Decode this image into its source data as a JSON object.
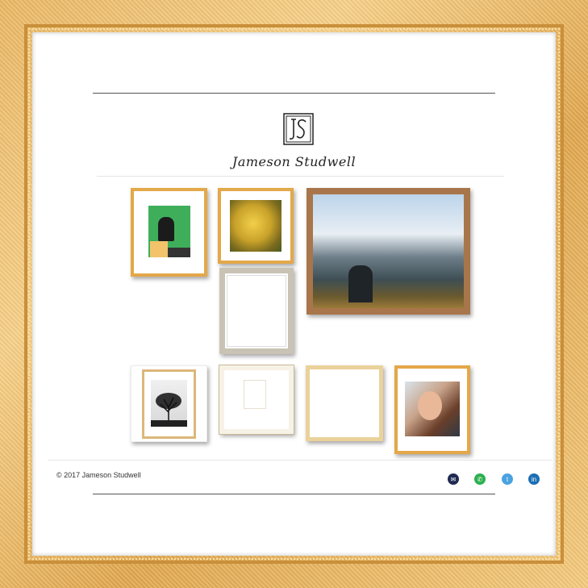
{
  "brand": {
    "name": "Jameson Studwell",
    "logo_letters": "JS"
  },
  "footer": {
    "copyright": "© 2017 Jameson Studwell"
  },
  "social": [
    {
      "icon": "email-icon",
      "color": "#1f2a52"
    },
    {
      "icon": "phone-icon",
      "color": "#2bb04f"
    },
    {
      "icon": "twitter-icon",
      "color": "#4aa3df"
    },
    {
      "icon": "linkedin-icon",
      "color": "#1c6eb3"
    }
  ],
  "colors": {
    "frame_gold": "#e3a84a",
    "frame_wood": "#a8764a",
    "background": "#ffffff"
  }
}
